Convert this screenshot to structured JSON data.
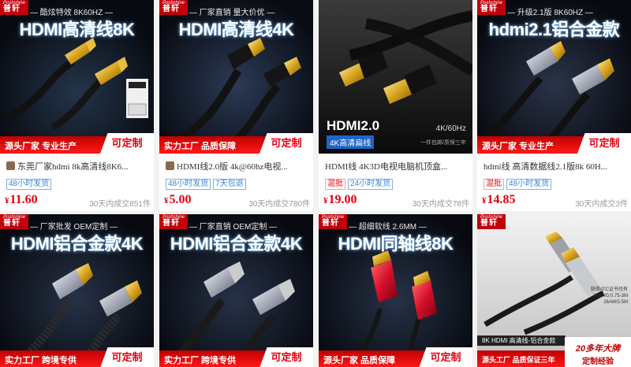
{
  "products": [
    {
      "brand_en": "Poshshine",
      "brand_cn": "普轩",
      "subtitle": "— 酷炫特效  8K60HZ —",
      "headline": "HDMI高清线8K",
      "footer_left": "源头厂家  专业生产",
      "footer_right": "可定制",
      "title": "东莞厂家hdmi 8k高清线8K6...",
      "tags": [
        "48小时发货"
      ],
      "currency": "¥",
      "price": "11.60",
      "sales": "30天内成交851件",
      "accent": "#e4000f"
    },
    {
      "brand_en": "Poshshine",
      "brand_cn": "普轩",
      "subtitle": "— 厂家直销  量大价优 —",
      "headline": "HDMI高清线4K",
      "footer_left": "实力工厂  品质保障",
      "footer_right": "可定制",
      "title": "HDMI线2.0版 4k@60hz电视...",
      "tags": [
        "48小时发货",
        "7天包退"
      ],
      "currency": "¥",
      "price": "5.00",
      "sales": "30天内成交780件"
    },
    {
      "brand_en": "",
      "brand_cn": "",
      "subtitle": "",
      "headline": "",
      "image_text_main": "HDMI2.0",
      "image_text_blue": "4K高清扁线",
      "image_text_right": "4K/60Hz",
      "image_text_small": "一件包邮/质保三年",
      "title": "HDMI线 4K3D电视电脑机顶盒...",
      "tags": [
        "混批",
        "24小时发货"
      ],
      "currency": "¥",
      "price": "19.00",
      "sales": "30天内成交78件"
    },
    {
      "brand_en": "Poshshine",
      "brand_cn": "普轩",
      "subtitle": "— 升级2.1版  8K60HZ —",
      "headline": "hdmi2.1铝合金款",
      "footer_left": "源头厂家  专业生产",
      "footer_right": "可定制",
      "title": "hdmi线 高清数据线2.1版8k 60H...",
      "tags": [
        "混批",
        "48小时发货"
      ],
      "currency": "¥",
      "price": "14.85",
      "sales": "30天内成交3件"
    },
    {
      "brand_en": "Poshshine",
      "brand_cn": "普轩",
      "subtitle": "— 厂家批发  OEM定制 —",
      "headline": "HDMI铝合金款4K",
      "footer_left": "实力工厂  跨境专供",
      "footer_right": "可定制"
    },
    {
      "brand_en": "Poshshine",
      "brand_cn": "普轩",
      "subtitle": "— 厂家直销  OEM定制 —",
      "headline": "HDMI铝合金款4K",
      "footer_left": "实力工厂  跨境专供",
      "footer_right": "可定制"
    },
    {
      "brand_en": "Poshshine",
      "brand_cn": "普轩",
      "subtitle": "— 超细软线  2.6MM —",
      "headline": "HDMI同轴线8K",
      "footer_left": "源头厂家  品质保障",
      "footer_right": "可定制"
    },
    {
      "brand_en": "Poshshine",
      "brand_cn": "普轩",
      "subtitle": "",
      "headline": "",
      "strip_text": "8K HDMI 高清线-铝合金款",
      "badge_top": "20多年大牌",
      "badge_bottom": "定制经验",
      "footer_left": "源头工厂 品质保证三年",
      "small_text_1": "获得ATC证书也有",
      "small_text_2": "30AWG:0.75-3M",
      "small_text_3": "26AWG:5M"
    }
  ]
}
